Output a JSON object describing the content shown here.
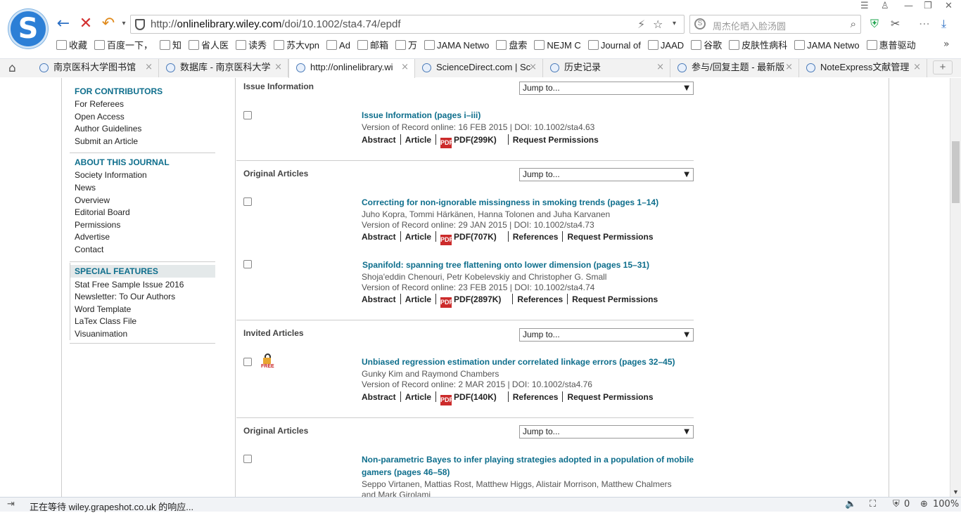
{
  "browser": {
    "url_prefix": "http://",
    "url_domain": "onlinelibrary.wiley.com",
    "url_path": "/doi/10.1002/sta4.74/epdf",
    "search_placeholder": "周杰伦晒入脸汤圆",
    "bookmarks": [
      {
        "label": "收藏",
        "icon": "star-icon"
      },
      {
        "label": "百度一下，",
        "icon": "baidu-icon"
      },
      {
        "label": "知",
        "icon": "zhihu-icon"
      },
      {
        "label": "省人医",
        "icon": "page-icon"
      },
      {
        "label": "读秀",
        "icon": "duxiu-icon"
      },
      {
        "label": "苏大vpn",
        "icon": "page-icon"
      },
      {
        "label": "Ad",
        "icon": "ad-icon"
      },
      {
        "label": "邮箱",
        "icon": "mail-icon"
      },
      {
        "label": "万",
        "icon": "wanfang-icon"
      },
      {
        "label": "JAMA Netwo",
        "icon": "page-icon"
      },
      {
        "label": "盘索",
        "icon": "search-icon"
      },
      {
        "label": "NEJM C",
        "icon": "nejm-icon"
      },
      {
        "label": "Journal of",
        "icon": "page-icon"
      },
      {
        "label": "JAAD",
        "icon": "page-icon"
      },
      {
        "label": "谷歌",
        "icon": "google-icon"
      },
      {
        "label": "皮肤性病科",
        "icon": "derm-icon"
      },
      {
        "label": "JAMA Netwo",
        "icon": "page-icon"
      },
      {
        "label": "惠普驱动",
        "icon": "page-icon"
      }
    ],
    "tabs": [
      {
        "label": "南京医科大学图书馆",
        "active": false
      },
      {
        "label": "数据库 - 南京医科大学",
        "active": false
      },
      {
        "label": "http://onlinelibrary.wi",
        "active": true
      },
      {
        "label": "ScienceDirect.com | Sc",
        "active": false
      },
      {
        "label": "历史记录",
        "active": false
      },
      {
        "label": "参与/回复主题 - 最新版",
        "active": false
      },
      {
        "label": "NoteExpress文献管理",
        "active": false
      }
    ],
    "status_text": "正在等待 wiley.grapeshot.co.uk 的响应...",
    "zoom": "100%",
    "status_count": "0"
  },
  "sidebar": {
    "contributors_heading": "FOR CONTRIBUTORS",
    "contributors_links": [
      "For Referees",
      "Open Access",
      "Author Guidelines",
      "Submit an Article"
    ],
    "about_heading": "ABOUT THIS JOURNAL",
    "about_links": [
      "Society Information",
      "News",
      "Overview",
      "Editorial Board",
      "Permissions",
      "Advertise",
      "Contact"
    ],
    "special_heading": "SPECIAL FEATURES",
    "special_links": [
      "Stat Free Sample Issue 2016",
      "Newsletter: To Our Authors",
      "Word Template",
      "LaTex Class File",
      "Visuanimation"
    ]
  },
  "jump_label": "Jump to...",
  "links": {
    "abstract": "Abstract",
    "article": "Article",
    "references": "References",
    "permissions": "Request Permissions"
  },
  "sections": [
    {
      "heading": "Issue Information"
    },
    {
      "heading": "Original Articles"
    },
    {
      "heading": "Invited Articles"
    },
    {
      "heading": "Original Articles"
    }
  ],
  "articles": [
    {
      "title": "Issue Information (pages i–iii)",
      "authors": "",
      "record": "Version of Record online: 16 FEB 2015 | DOI: 10.1002/sta4.63",
      "pdf": "PDF(299K)"
    },
    {
      "title": "Correcting for non-ignorable missingness in smoking trends (pages 1–14)",
      "authors": "Juho Kopra, Tommi Härkänen, Hanna Tolonen and Juha Karvanen",
      "record": "Version of Record online: 29 JAN 2015 | DOI: 10.1002/sta4.73",
      "pdf": "PDF(707K)"
    },
    {
      "title": "Spanifold: spanning tree flattening onto lower dimension (pages 15–31)",
      "authors": "Shoja'eddin Chenouri, Petr Kobelevskiy and Christopher G. Small",
      "record": "Version of Record online: 23 FEB 2015 | DOI: 10.1002/sta4.74",
      "pdf": "PDF(2897K)"
    },
    {
      "title": "Unbiased regression estimation under correlated linkage errors (pages 32–45)",
      "authors": "Gunky Kim and Raymond Chambers",
      "record": "Version of Record online: 2 MAR 2015 | DOI: 10.1002/sta4.76",
      "pdf": "PDF(140K)",
      "free_label": "FREE"
    },
    {
      "title_line1": "Non-parametric Bayes to infer playing strategies adopted in a population of mobile",
      "title_line2": "gamers (pages 46–58)",
      "authors_line1": "Seppo Virtanen, Mattias Rost, Matthew Higgs, Alistair Morrison, Matthew Chalmers",
      "authors_line2": "and Mark Girolami"
    }
  ]
}
